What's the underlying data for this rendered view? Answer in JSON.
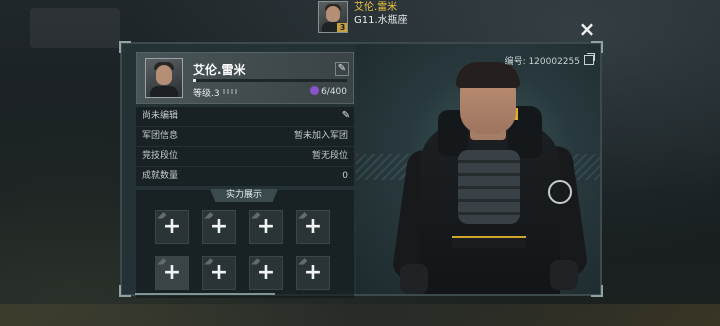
{
  "top_profile": {
    "name": "艾伦.雷米",
    "server": "G11.水瓶座",
    "level_badge": "3"
  },
  "close_icon": "×",
  "profile_card": {
    "name": "艾伦.雷米",
    "level_label": "等级.3",
    "exp_value": "6/400",
    "exp_progress": 0.015
  },
  "signature": "尚未编辑",
  "info_rows": [
    {
      "label": "军团信息",
      "value": "暂未加入军团"
    },
    {
      "label": "竞技段位",
      "value": "暂无段位"
    },
    {
      "label": "成就数量",
      "value": "0"
    }
  ],
  "showcase": {
    "title": "实力展示",
    "slot_symbol": "+",
    "slots": 8
  },
  "character": {
    "id_label": "编号: 120002255"
  },
  "colors": {
    "accent_gold": "#f0c53c",
    "exp_icon_purple": "#8b53c9"
  }
}
